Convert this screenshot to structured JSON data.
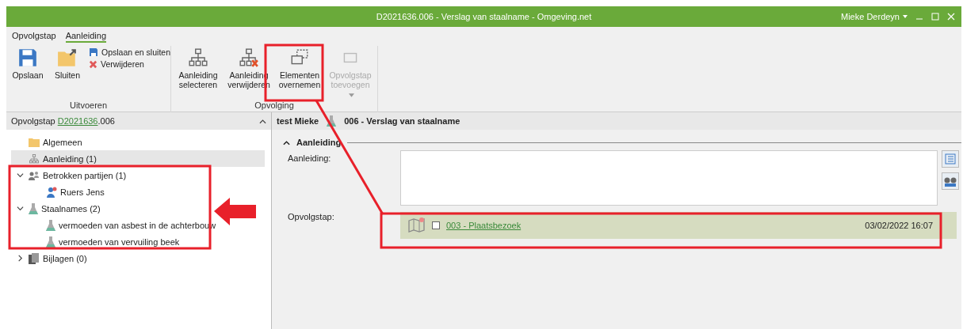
{
  "window": {
    "title": "D2021636.006 - Verslag van staalname - Omgeving.net",
    "user": "Mieke Derdeyn"
  },
  "ribbon": {
    "tabs": [
      {
        "label": "Opvolgstap",
        "selected": false
      },
      {
        "label": "Aanleiding",
        "selected": true
      }
    ],
    "groups": [
      {
        "label": "Uitvoeren",
        "buttons": [
          {
            "kind": "save",
            "label": "Opslaan",
            "disabled": false
          },
          {
            "kind": "close",
            "label": "Sluiten",
            "disabled": false
          },
          {
            "kind": "saveclose",
            "label": "Opslaan en sluiten",
            "disabled": false
          },
          {
            "kind": "delete",
            "label": "Verwijderen",
            "disabled": false
          }
        ]
      },
      {
        "label": "Opvolging",
        "buttons": [
          {
            "kind": "select",
            "label": "Aanleiding selecteren",
            "disabled": false
          },
          {
            "kind": "remove",
            "label": "Aanleiding verwijderen",
            "disabled": false
          },
          {
            "kind": "copy",
            "label": "Elementen overnemen",
            "disabled": false
          },
          {
            "kind": "add",
            "label": "Opvolgstap toevoegen",
            "disabled": true
          }
        ]
      }
    ]
  },
  "left_panel": {
    "header": {
      "label": "Opvolgstap",
      "link": "D2021636",
      "suffix": ".006"
    },
    "tree": [
      {
        "kind": "folder",
        "label": "Algemeen",
        "selected": false
      },
      {
        "kind": "network",
        "label": "Aanleiding (1)",
        "selected": true
      },
      {
        "kind": "people",
        "label": "Betrokken partijen (1)",
        "selected": false,
        "expanded": true,
        "children": [
          {
            "kind": "person",
            "label": "Ruers Jens",
            "selected": false
          }
        ]
      },
      {
        "kind": "flask",
        "label": "Staalnames (2)",
        "selected": false,
        "expanded": true,
        "children": [
          {
            "kind": "flask",
            "label": "vermoeden van asbest in de achterbouw",
            "selected": false
          },
          {
            "kind": "flask",
            "label": "vermoeden van vervuiling beek",
            "selected": false
          }
        ]
      },
      {
        "kind": "attachment",
        "label": "Bijlagen (0)",
        "selected": false,
        "expanded": false
      }
    ]
  },
  "right_panel": {
    "header": {
      "user": "test Mieke",
      "title": "006 - Verslag van staalname"
    },
    "section": {
      "title": "Aanleiding",
      "expanded": true
    },
    "fields": [
      {
        "label": "Aanleiding:"
      },
      {
        "label": "Opvolgstap:",
        "item": {
          "label": "003 - Plaatsbezoek",
          "date": "03/02/2022 16:07",
          "checked": false
        }
      }
    ]
  }
}
